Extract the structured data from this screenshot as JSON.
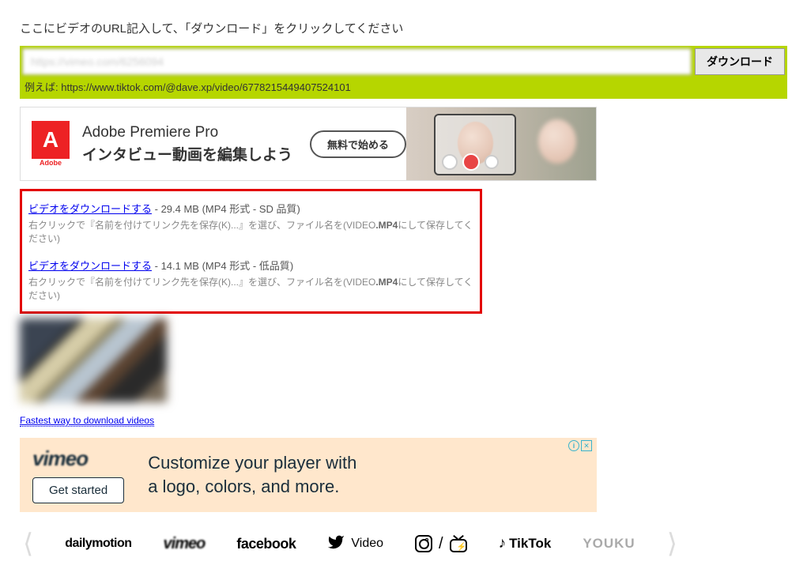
{
  "instruction": "ここにビデオのURL記入して、「ダウンロード」をクリックしてください",
  "url_input_value": "https://vimeo.com/6256094",
  "download_button": "ダウンロード",
  "example_text": "例えば: https://www.tiktok.com/@dave.xp/video/6778215449407524101",
  "ad1": {
    "logo_letter": "A",
    "logo_under": "Adobe",
    "title": "Adobe Premiere Pro",
    "subtitle": "インタビュー動画を編集しよう",
    "cta": "無料で始める"
  },
  "downloads": [
    {
      "link": "ビデオをダウンロードする",
      "meta": " - 29.4 MB (MP4 形式 - SD 品質)",
      "hint_prefix": "右クリックで『名前を付けてリンク先を保存(K)...』を選び、ファイル名を(VIDEO",
      "hint_bold": ".MP4",
      "hint_suffix": "にして保存してください)"
    },
    {
      "link": "ビデオをダウンロードする",
      "meta": " - 14.1 MB (MP4 形式 - 低品質)",
      "hint_prefix": "右クリックで『名前を付けてリンク先を保存(K)...』を選び、ファイル名を(VIDEO",
      "hint_bold": ".MP4",
      "hint_suffix": "にして保存してください)"
    }
  ],
  "fastest_link": "Fastest way to download videos",
  "ad2": {
    "logo": "vimeo",
    "cta": "Get started",
    "line1": "Customize your player with",
    "line2": "a logo, colors, and more."
  },
  "sites": {
    "dailymotion": "dailymotion",
    "vimeo": "vimeo",
    "facebook": "facebook",
    "video": "Video",
    "slash": "/",
    "tiktok": "TikTok",
    "youku": "YOUKU"
  }
}
